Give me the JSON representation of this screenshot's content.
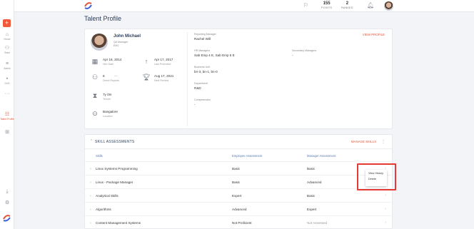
{
  "colors": {
    "accent": "#e0533a",
    "brand_blue": "#2b3e5a",
    "highlight": "#e53935"
  },
  "rail": {
    "items": [
      {
        "icon": "home-icon",
        "glyph": "⌂",
        "label": "Home"
      },
      {
        "icon": "team-icon",
        "glyph": "⚇",
        "label": "Team"
      },
      {
        "icon": "admin-icon",
        "glyph": "≡",
        "label": "Admin"
      },
      {
        "icon": "goals-icon",
        "glyph": "▪",
        "label": "GoG"
      },
      {
        "icon": "more-icon",
        "glyph": "···",
        "label": ""
      },
      {
        "icon": "talent-profile-icon",
        "glyph": "☷",
        "label": "Talent Profile"
      },
      {
        "icon": "grid-icon",
        "glyph": "⊞",
        "label": ""
      },
      {
        "icon": "download-icon",
        "glyph": "⤓",
        "label": ""
      },
      {
        "icon": "settings-icon",
        "glyph": "⚙",
        "label": ""
      }
    ]
  },
  "topbar": {
    "points_value": "155",
    "points_label": "POINTS",
    "ranked_value": "2",
    "ranked_label": "RANKED"
  },
  "page": {
    "title": "Talent Profile"
  },
  "profile": {
    "name": "John Michael",
    "role": "QA Manager",
    "dept_code": "EM1",
    "hire_date": "Apr 18, 2014",
    "hire_date_label": "Hire Date",
    "last_promoted": "Apr 17, 2017",
    "last_promoted_label": "Last Promoted",
    "direct_reports": "8",
    "direct_reports_dash": "—",
    "direct_reports_label": "Direct Reports",
    "next_review": "Aug 17, 2021",
    "next_review_label": "Next Review",
    "tenure": "7y 0m",
    "tenure_label": "Tenure",
    "location": "Bangalore",
    "location_label": "Location",
    "reporting_manager_label": "Reporting Manager",
    "reporting_manager": "Rachel Will",
    "hr_managers_label": "HR Managers",
    "hr_managers": "Sab Emp 4 E, Sab Emp 5 E",
    "secondary_managers_label": "Secondary Managers",
    "secondary_managers": "-",
    "business_unit_label": "Business Unit",
    "business_unit": "bn-3, bn-1, bn-0",
    "department_label": "Department",
    "department": "R&D",
    "competencies_label": "Competencies",
    "competencies": "-",
    "view_profile": "VIEW PROFILE"
  },
  "skills": {
    "title": "SKILL ASSESSMENTS",
    "manage": "MANAGE SKILLS",
    "headers": {
      "skill": "Skills",
      "employee": "Employee Assessment",
      "manager": "Manager Assessment"
    },
    "rows": [
      {
        "skill": "Linux Systems Programming",
        "employee": "Basic",
        "manager": "Basic"
      },
      {
        "skill": "Linux - Package Manager",
        "employee": "Basic",
        "manager": "Advanced"
      },
      {
        "skill": "Analytical Skills",
        "employee": "Expert",
        "manager": "Basic"
      },
      {
        "skill": "Algorithms",
        "employee": "Advanced",
        "manager": "Expert"
      },
      {
        "skill": "Content Management Systems",
        "employee": "Not Proficient",
        "manager": "Not Assessed"
      }
    ]
  },
  "context_menu": {
    "items": [
      "View History",
      "Delete"
    ]
  }
}
